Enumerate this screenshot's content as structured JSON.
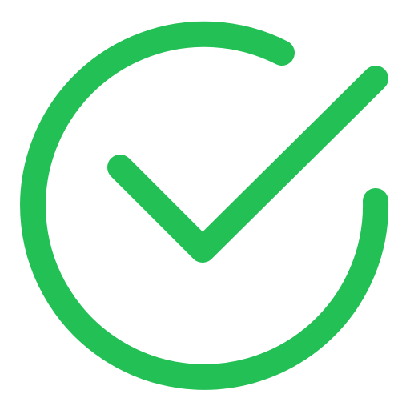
{
  "icon": {
    "name": "check-circle-icon",
    "color": "#22c055"
  }
}
